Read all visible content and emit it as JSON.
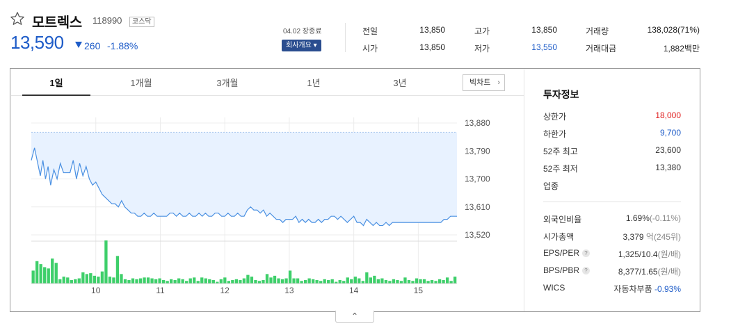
{
  "stock": {
    "name": "모트렉스",
    "code": "118990",
    "market": "코스닥",
    "price": "13,590",
    "change": "260",
    "change_pct": "-1.88%",
    "direction": "down",
    "down_color": "#1e5cc8",
    "up_color": "#e02020"
  },
  "header": {
    "date_label": "04.02 장종료",
    "company_button": "회사개요 ▾"
  },
  "summary": [
    {
      "label": "전일",
      "value": "13,850"
    },
    {
      "label": "시가",
      "value": "13,850"
    },
    {
      "label": "고가",
      "value": "13,850"
    },
    {
      "label": "저가",
      "value": "13,550",
      "color": "blue"
    },
    {
      "label": "거래량",
      "value": "138,028(71%)"
    },
    {
      "label": "거래대금",
      "value": "1,882백만"
    }
  ],
  "tabs": [
    "1일",
    "1개월",
    "3개월",
    "1년",
    "3년"
  ],
  "active_tab": "1일",
  "bigchart_label": "빅차트",
  "chart_data": {
    "type": "line",
    "line_color": "#4a90e2",
    "fill_color": "#e8f2ff",
    "volume_color": "#3ecf6a",
    "y_ticks": [
      "13,880",
      "13,790",
      "13,700",
      "13,610",
      "13,520"
    ],
    "ylim": [
      13520,
      13880
    ],
    "prev_close": 13850,
    "x_ticks": [
      "10",
      "11",
      "12",
      "13",
      "14",
      "15"
    ],
    "xlim": [
      9.0,
      15.6
    ],
    "x_tick_values": [
      10,
      11,
      12,
      13,
      14,
      15
    ],
    "prices": [
      [
        9.0,
        13760
      ],
      [
        9.05,
        13800
      ],
      [
        9.1,
        13750
      ],
      [
        9.14,
        13710
      ],
      [
        9.18,
        13760
      ],
      [
        9.22,
        13700
      ],
      [
        9.26,
        13740
      ],
      [
        9.3,
        13680
      ],
      [
        9.35,
        13730
      ],
      [
        9.4,
        13700
      ],
      [
        9.45,
        13750
      ],
      [
        9.5,
        13720
      ],
      [
        9.55,
        13720
      ],
      [
        9.6,
        13720
      ],
      [
        9.65,
        13760
      ],
      [
        9.7,
        13700
      ],
      [
        9.75,
        13750
      ],
      [
        9.8,
        13710
      ],
      [
        9.85,
        13740
      ],
      [
        9.9,
        13700
      ],
      [
        9.95,
        13680
      ],
      [
        10.0,
        13690
      ],
      [
        10.05,
        13670
      ],
      [
        10.1,
        13650
      ],
      [
        10.15,
        13640
      ],
      [
        10.2,
        13630
      ],
      [
        10.25,
        13620
      ],
      [
        10.3,
        13620
      ],
      [
        10.35,
        13610
      ],
      [
        10.4,
        13630
      ],
      [
        10.45,
        13610
      ],
      [
        10.5,
        13600
      ],
      [
        10.55,
        13590
      ],
      [
        10.6,
        13590
      ],
      [
        10.65,
        13580
      ],
      [
        10.7,
        13580
      ],
      [
        10.75,
        13590
      ],
      [
        10.8,
        13580
      ],
      [
        10.85,
        13580
      ],
      [
        10.9,
        13590
      ],
      [
        10.95,
        13580
      ],
      [
        11.0,
        13580
      ],
      [
        11.05,
        13580
      ],
      [
        11.1,
        13580
      ],
      [
        11.15,
        13590
      ],
      [
        11.2,
        13590
      ],
      [
        11.25,
        13580
      ],
      [
        11.3,
        13590
      ],
      [
        11.35,
        13580
      ],
      [
        11.4,
        13580
      ],
      [
        11.45,
        13590
      ],
      [
        11.5,
        13580
      ],
      [
        11.55,
        13580
      ],
      [
        11.6,
        13590
      ],
      [
        11.65,
        13580
      ],
      [
        11.7,
        13590
      ],
      [
        11.75,
        13580
      ],
      [
        11.8,
        13580
      ],
      [
        11.85,
        13590
      ],
      [
        11.9,
        13590
      ],
      [
        11.95,
        13580
      ],
      [
        12.0,
        13580
      ],
      [
        12.05,
        13590
      ],
      [
        12.1,
        13580
      ],
      [
        12.15,
        13580
      ],
      [
        12.2,
        13590
      ],
      [
        12.25,
        13580
      ],
      [
        12.3,
        13580
      ],
      [
        12.35,
        13600
      ],
      [
        12.4,
        13610
      ],
      [
        12.45,
        13600
      ],
      [
        12.5,
        13600
      ],
      [
        12.55,
        13590
      ],
      [
        12.6,
        13600
      ],
      [
        12.65,
        13580
      ],
      [
        12.7,
        13590
      ],
      [
        12.75,
        13580
      ],
      [
        12.8,
        13570
      ],
      [
        12.85,
        13570
      ],
      [
        12.9,
        13560
      ],
      [
        12.95,
        13570
      ],
      [
        13.0,
        13570
      ],
      [
        13.05,
        13570
      ],
      [
        13.1,
        13580
      ],
      [
        13.15,
        13560
      ],
      [
        13.2,
        13570
      ],
      [
        13.25,
        13560
      ],
      [
        13.3,
        13570
      ],
      [
        13.35,
        13560
      ],
      [
        13.4,
        13560
      ],
      [
        13.45,
        13570
      ],
      [
        13.5,
        13560
      ],
      [
        13.55,
        13570
      ],
      [
        13.6,
        13570
      ],
      [
        13.65,
        13580
      ],
      [
        13.7,
        13580
      ],
      [
        13.75,
        13570
      ],
      [
        13.8,
        13580
      ],
      [
        13.85,
        13570
      ],
      [
        13.9,
        13560
      ],
      [
        13.95,
        13570
      ],
      [
        14.0,
        13580
      ],
      [
        14.05,
        13560
      ],
      [
        14.1,
        13560
      ],
      [
        14.15,
        13550
      ],
      [
        14.2,
        13570
      ],
      [
        14.25,
        13560
      ],
      [
        14.3,
        13550
      ],
      [
        14.35,
        13560
      ],
      [
        14.4,
        13550
      ],
      [
        14.45,
        13550
      ],
      [
        14.5,
        13560
      ],
      [
        14.55,
        13550
      ],
      [
        14.6,
        13560
      ],
      [
        14.65,
        13560
      ],
      [
        14.7,
        13560
      ],
      [
        14.75,
        13560
      ],
      [
        14.8,
        13560
      ],
      [
        14.85,
        13560
      ],
      [
        14.9,
        13560
      ],
      [
        14.95,
        13560
      ],
      [
        15.0,
        13560
      ],
      [
        15.05,
        13560
      ],
      [
        15.1,
        13560
      ],
      [
        15.15,
        13560
      ],
      [
        15.2,
        13560
      ],
      [
        15.25,
        13560
      ],
      [
        15.3,
        13560
      ],
      [
        15.35,
        13560
      ],
      [
        15.4,
        13570
      ],
      [
        15.45,
        13570
      ],
      [
        15.5,
        13580
      ],
      [
        15.55,
        13580
      ]
    ],
    "volumes": [
      0.3,
      0.52,
      0.45,
      0.38,
      0.35,
      0.58,
      0.48,
      0.1,
      0.16,
      0.14,
      0.08,
      0.1,
      0.12,
      0.26,
      0.22,
      0.24,
      0.18,
      0.16,
      0.28,
      1.0,
      0.16,
      0.14,
      0.64,
      0.22,
      0.1,
      0.08,
      0.12,
      0.1,
      0.12,
      0.14,
      0.14,
      0.12,
      0.1,
      0.12,
      0.08,
      0.06,
      0.1,
      0.08,
      0.12,
      0.1,
      0.06,
      0.12,
      0.14,
      0.06,
      0.14,
      0.12,
      0.1,
      0.08,
      0.04,
      0.1,
      0.14,
      0.06,
      0.08,
      0.1,
      0.08,
      0.12,
      0.2,
      0.16,
      0.08,
      0.06,
      0.08,
      0.22,
      0.14,
      0.18,
      0.12,
      0.1,
      0.12,
      0.3,
      0.12,
      0.12,
      0.06,
      0.08,
      0.12,
      0.1,
      0.08,
      0.06,
      0.1,
      0.08,
      0.1,
      0.04,
      0.08,
      0.06,
      0.14,
      0.1,
      0.16,
      0.12,
      0.06,
      0.26,
      0.14,
      0.18,
      0.1,
      0.12,
      0.08,
      0.06,
      0.1,
      0.08,
      0.06,
      0.14,
      0.08,
      0.06,
      0.12,
      0.1,
      0.1,
      0.06,
      0.08,
      0.06,
      0.1,
      0.08,
      0.14,
      0.06,
      0.16
    ]
  },
  "info": {
    "title": "투자정보",
    "rows_top": [
      {
        "label": "상한가",
        "value": "18,000",
        "color": "red"
      },
      {
        "label": "하한가",
        "value": "9,700",
        "color": "blue"
      },
      {
        "label": "52주 최고",
        "value": "23,600"
      },
      {
        "label": "52주 최저",
        "value": "13,380"
      },
      {
        "label": "업종",
        "value": ""
      }
    ],
    "foreign_ratio_label": "외국인비율",
    "foreign_ratio_value": "1.69%",
    "foreign_ratio_change": "(-0.11%)",
    "market_cap_label": "시가총액",
    "market_cap_value": "3,379",
    "market_cap_unit": "억",
    "market_cap_rank": "(245위)",
    "eps_label": "EPS/PER",
    "eps_value": "1,325/10.4",
    "eps_unit": "(원/배)",
    "bps_label": "BPS/PBR",
    "bps_value": "8,377/1.65",
    "bps_unit": "(원/배)",
    "wics_label": "WICS",
    "wics_value": "자동차부품",
    "wics_change": "-0.93%",
    "help_glyph": "?"
  },
  "toggle_glyph": "⌃"
}
